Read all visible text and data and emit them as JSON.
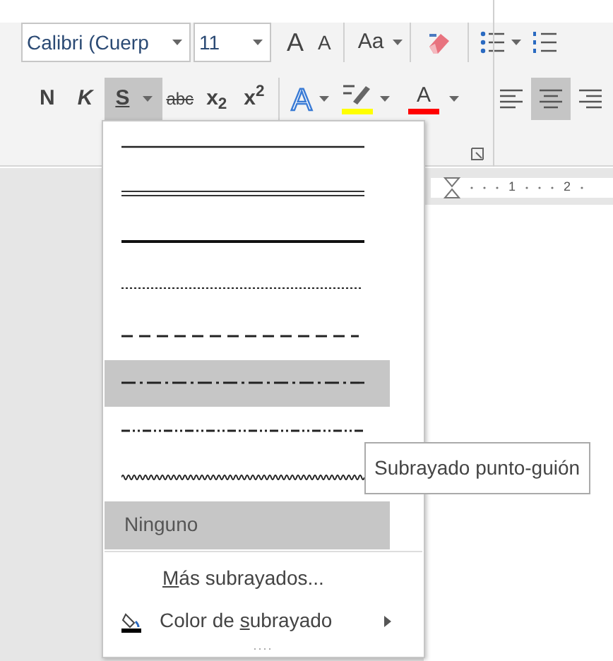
{
  "ribbon": {
    "font_name": "Calibri (Cuerp",
    "font_size": "11",
    "grow_font": "A",
    "shrink_font": "A",
    "change_case": "Aa",
    "format_buttons": [
      {
        "kind": "bold",
        "label": "N",
        "selected": false
      },
      {
        "kind": "italic",
        "label": "K",
        "selected": false
      },
      {
        "kind": "underline",
        "label": "S",
        "selected": true
      },
      {
        "kind": "strike",
        "label": "abc",
        "selected": false
      },
      {
        "kind": "plain",
        "label": "x$_{2}$",
        "selected": false
      },
      {
        "kind": "plain",
        "label": "x$^{2}$",
        "selected": false
      }
    ],
    "text_effects": "A",
    "font_color_label": "A",
    "align_buttons": [
      {
        "kind": "left",
        "selected": false
      },
      {
        "kind": "center",
        "selected": true
      },
      {
        "kind": "right",
        "selected": false
      }
    ]
  },
  "ruler": {
    "labels": [
      "1",
      "2"
    ]
  },
  "underline_menu": {
    "items": [
      {
        "kind": "solid",
        "highlighted": false
      },
      {
        "kind": "double",
        "highlighted": false
      },
      {
        "kind": "thick",
        "highlighted": false
      },
      {
        "kind": "dotted",
        "highlighted": false
      },
      {
        "kind": "dashed",
        "highlighted": false
      },
      {
        "kind": "dashdot",
        "highlighted": true
      },
      {
        "kind": "dashdotdot",
        "highlighted": false
      },
      {
        "kind": "wave",
        "highlighted": false
      },
      {
        "kind": "text",
        "label": "Ninguno",
        "highlighted": true
      }
    ],
    "commands": [
      {
        "kind": "dialog",
        "key": "M",
        "label_rest": "ás subrayados..."
      },
      {
        "kind": "submenu",
        "label_start": "Color de ",
        "key": "s",
        "label_rest": "ubrayado"
      }
    ]
  },
  "tooltip": "Subrayado punto-guión"
}
